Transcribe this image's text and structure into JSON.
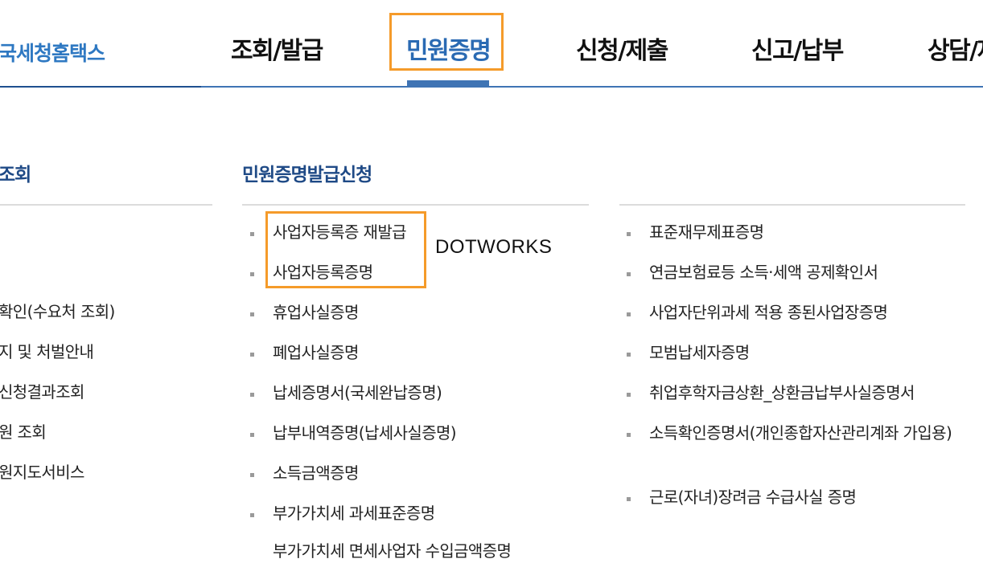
{
  "header": {
    "logo": "국세청홈택스",
    "nav": [
      "조회/발급",
      "민원증명",
      "신청/제출",
      "신고/납부",
      "상담/제보"
    ]
  },
  "left_column": {
    "title": "조회",
    "items": [
      "확인(수요처 조회)",
      "지 및 처벌안내",
      "신청결과조회",
      "원 조회",
      "원지도서비스"
    ]
  },
  "middle_column": {
    "title": "민원증명발급신청",
    "items": [
      "사업자등록증 재발급",
      "사업자등록증명",
      "휴업사실증명",
      "폐업사실증명",
      "납세증명서(국세완납증명)",
      "납부내역증명(납세사실증명)",
      "소득금액증명",
      "부가가치세 과세표준증명",
      "부가가치세 면세사업자 수입금액증명"
    ]
  },
  "right_column": {
    "items": [
      "표준재무제표증명",
      "연금보험료등 소득·세액 공제확인서",
      "사업자단위과세 적용 종된사업장증명",
      "모범납세자증명",
      "취업후학자금상환_상환금납부사실증명서",
      "소득확인증명서(개인종합자산관리계좌 가입용)",
      "근로(자녀)장려금 수급사실 증명"
    ]
  },
  "annotation": {
    "label": "DOTWORKS"
  },
  "colors": {
    "accent": "#3f74b4",
    "highlight": "#f59b2a",
    "title": "#1f4a86"
  }
}
